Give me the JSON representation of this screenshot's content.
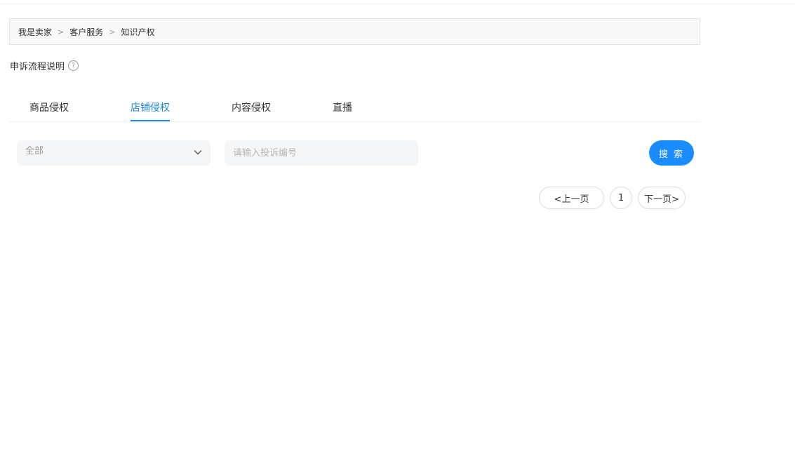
{
  "breadcrumb": {
    "items": [
      "我是卖家",
      "客户服务",
      "知识产权"
    ],
    "separator": ">"
  },
  "appeal": {
    "label": "申诉流程说明",
    "help_glyph": "?"
  },
  "tabs": [
    {
      "label": "商品侵权",
      "active": false
    },
    {
      "label": "店铺侵权",
      "active": true
    },
    {
      "label": "内容侵权",
      "active": false
    },
    {
      "label": "直播",
      "active": false
    }
  ],
  "filter": {
    "select_value": "全部",
    "search_placeholder": "请输入投诉编号",
    "search_button": "搜 索"
  },
  "pagination": {
    "prev_label": "<上一页",
    "current_page": "1",
    "next_label": "下一页>"
  },
  "colors": {
    "accent": "#1a8cff",
    "active_tab": "#1e88e5"
  }
}
